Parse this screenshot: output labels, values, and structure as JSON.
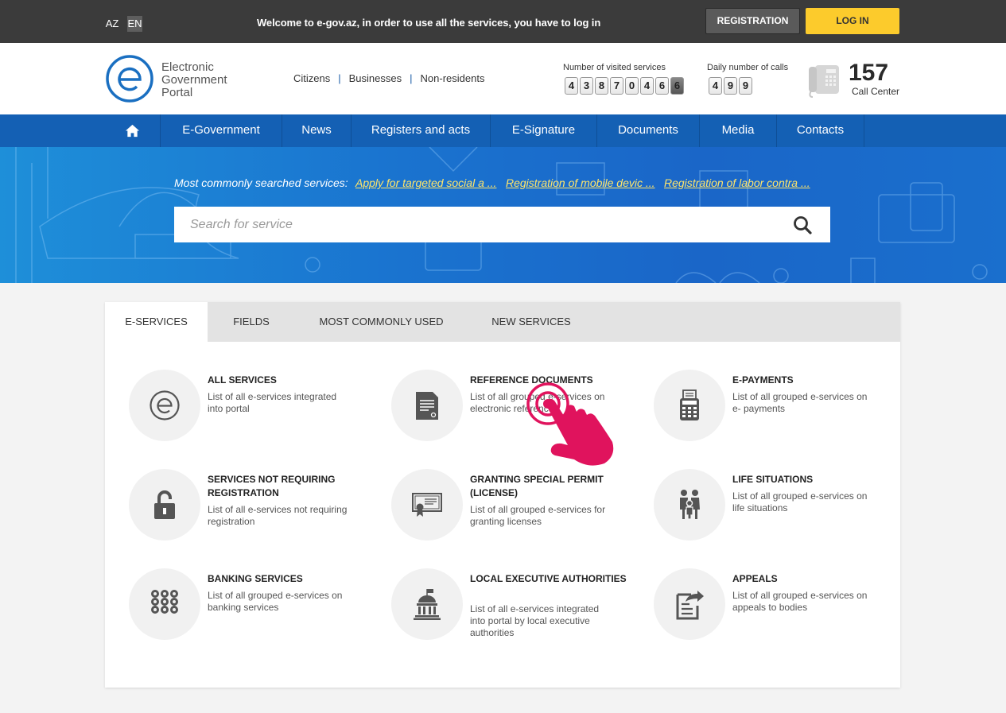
{
  "topbar": {
    "lang_az": "AZ",
    "lang_en": "EN",
    "welcome": "Welcome to e-gov.az, in order to use all the services, you have to log in",
    "registration": "REGISTRATION",
    "login": "LOG IN"
  },
  "header": {
    "logo_lines": [
      "Electronic",
      "Government",
      "Portal"
    ],
    "audience": [
      "Citizens",
      "Businesses",
      "Non-residents"
    ],
    "visited_label": "Number of visited services",
    "visited_digits": [
      "4",
      "3",
      "8",
      "7",
      "0",
      "4",
      "6",
      "6"
    ],
    "calls_label": "Daily number of calls",
    "calls_digits": [
      "4",
      "9",
      "9"
    ],
    "call_number": "157",
    "call_label": "Call Center"
  },
  "nav": {
    "items": [
      "E-Government",
      "News",
      "Registers and acts",
      "E-Signature",
      "Documents",
      "Media",
      "Contacts"
    ]
  },
  "hero": {
    "popular_label": "Most commonly searched services:",
    "popular_links": [
      "Apply for targeted social a ...",
      "Registration of mobile devic ...",
      "Registration of labor contra ..."
    ],
    "search_placeholder": "Search for service"
  },
  "tabs": [
    "E-SERVICES",
    "FIELDS",
    "MOST COMMONLY USED",
    "NEW SERVICES"
  ],
  "services": [
    {
      "title": "ALL SERVICES",
      "desc": "List of all e-services integrated into portal",
      "icon": "egov-logo-icon"
    },
    {
      "title": "REFERENCE DOCUMENTS",
      "desc": "List of all grouped e-services on electronic references",
      "icon": "document-icon"
    },
    {
      "title": "E-PAYMENTS",
      "desc": "List of all grouped e-services on e- payments",
      "icon": "calculator-icon"
    },
    {
      "title": "SERVICES NOT REQUIRING REGISTRATION",
      "desc": "List of all e-services not requiring registration",
      "icon": "unlock-icon"
    },
    {
      "title": "GRANTING SPECIAL PERMIT (LICENSE)",
      "desc": "List of all grouped e-services for granting licenses",
      "icon": "certificate-icon"
    },
    {
      "title": "LIFE SITUATIONS",
      "desc": "List of all grouped e-services on life situations",
      "icon": "family-icon"
    },
    {
      "title": "BANKING SERVICES",
      "desc": "List of all grouped e-services on banking services",
      "icon": "keypad-icon"
    },
    {
      "title": "LOCAL EXECUTIVE AUTHORITIES",
      "desc": "List of all e-services integrated into portal by local executive authorities",
      "icon": "government-building-icon"
    },
    {
      "title": "APPEALS",
      "desc": "List of all grouped e-services on appeals to bodies",
      "icon": "appeal-icon"
    }
  ],
  "colors": {
    "topbar": "#3b3b3b",
    "nav": "#1460b4",
    "login": "#fccb2c",
    "link": "#ffe56a",
    "cursor": "#e0135d"
  }
}
